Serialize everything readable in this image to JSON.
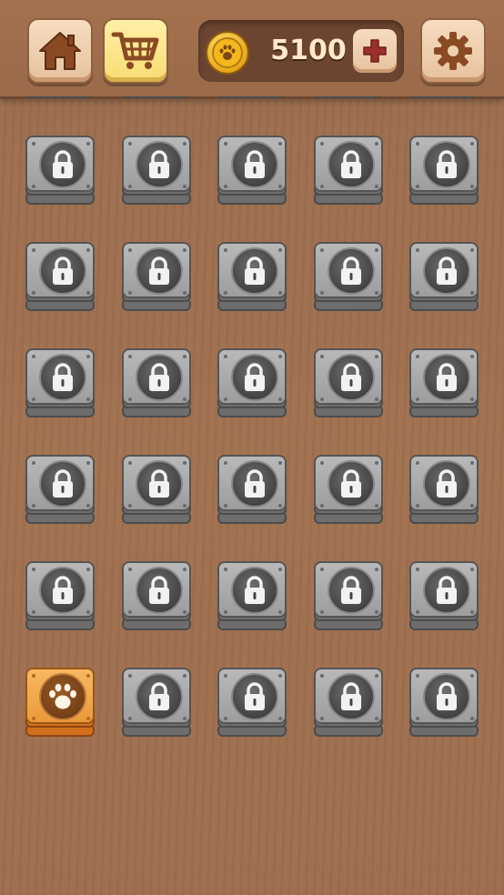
{
  "header": {
    "home_icon": "home-icon",
    "shop_icon": "shopping-cart-icon",
    "coin_icon": "paw-coin-icon",
    "coins": "5100",
    "add_icon": "plus-icon",
    "settings_icon": "gear-icon"
  },
  "levels": {
    "columns": 5,
    "rows": [
      [
        "locked",
        "locked",
        "locked",
        "locked",
        "locked"
      ],
      [
        "locked",
        "locked",
        "locked",
        "locked",
        "locked"
      ],
      [
        "locked",
        "locked",
        "locked",
        "locked",
        "locked"
      ],
      [
        "locked",
        "locked",
        "locked",
        "locked",
        "locked"
      ],
      [
        "locked",
        "locked",
        "locked",
        "locked",
        "locked"
      ],
      [
        "locked",
        "locked",
        "locked",
        "locked",
        "locked"
      ],
      [
        "unlocked",
        "locked",
        "locked",
        "locked",
        "locked"
      ]
    ],
    "locked_icon": "padlock-icon",
    "unlocked_icon": "paw-icon"
  },
  "colors": {
    "background": "#9d6e4f",
    "locked_tile": "#a8a8a8",
    "unlocked_tile": "#eea54a",
    "coin_text": "#ffe9c8"
  }
}
